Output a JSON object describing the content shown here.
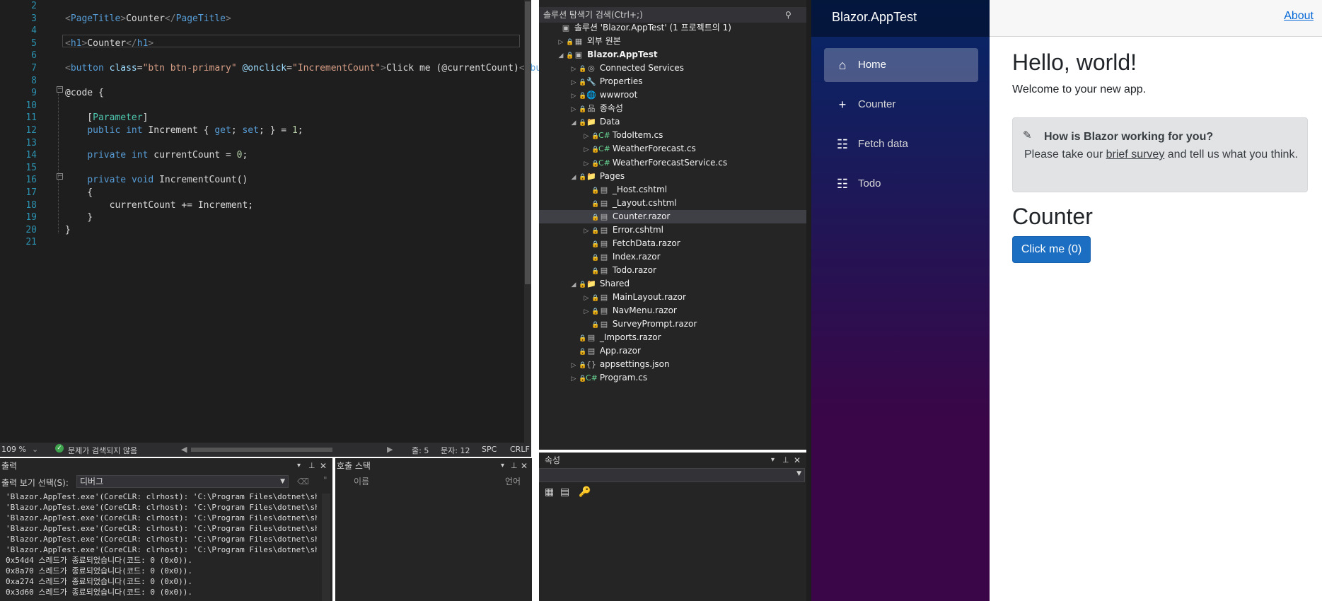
{
  "editor": {
    "lines": [
      {
        "n": "2",
        "html": ""
      },
      {
        "n": "3",
        "html": "<span class='gr'>&lt;</span><span class='tag'>PageTitle</span><span class='gr'>&gt;</span>Counter<span class='gr'>&lt;/</span><span class='tag'>PageTitle</span><span class='gr'>&gt;</span>"
      },
      {
        "n": "4",
        "html": ""
      },
      {
        "n": "5",
        "html": "<span class='gr'>&lt;</span><span class='tag'>h1</span><span class='gr'>&gt;</span>Counter<span class='gr'>&lt;/</span><span class='tag'>h1</span><span class='gr'>&gt;</span>"
      },
      {
        "n": "6",
        "html": ""
      },
      {
        "n": "7",
        "html": "<span class='gr'>&lt;</span><span class='tag'>button</span> <span class='at'>class</span>=<span class='st'>\"btn btn-primary\"</span> <span class='at'>@onclick</span>=<span class='st'>\"IncrementCount\"</span><span class='gr'>&gt;</span>Click me (@currentCount)<span class='gr'>&lt;/</span><span class='tag'>button</span><span class='gr'>&gt;</span>"
      },
      {
        "n": "8",
        "html": ""
      },
      {
        "n": "9",
        "html": "@code {"
      },
      {
        "n": "10",
        "html": ""
      },
      {
        "n": "11",
        "html": "    [<span class='cl2'>Parameter</span>]"
      },
      {
        "n": "12",
        "html": "    <span class='kw'>public</span> <span class='kw'>int</span> Increment { <span class='kw'>get</span>; <span class='kw'>set</span>; } = <span class='nm'>1</span>;"
      },
      {
        "n": "13",
        "html": ""
      },
      {
        "n": "14",
        "html": "    <span class='kw'>private</span> <span class='kw'>int</span> currentCount = <span class='nm'>0</span>;"
      },
      {
        "n": "15",
        "html": ""
      },
      {
        "n": "16",
        "html": "    <span class='kw'>private</span> <span class='kw'>void</span> IncrementCount()"
      },
      {
        "n": "17",
        "html": "    {"
      },
      {
        "n": "18",
        "html": "        currentCount += Increment;"
      },
      {
        "n": "19",
        "html": "    }"
      },
      {
        "n": "20",
        "html": "}"
      },
      {
        "n": "21",
        "html": ""
      }
    ]
  },
  "status": {
    "zoom": "109 %",
    "issues": "문제가 검색되지 않음",
    "line": "줄: 5",
    "col": "문자: 12",
    "spc": "SPC",
    "crlf": "CRLF"
  },
  "output": {
    "title": "출력",
    "show_label": "출력 보기 선택(S):",
    "show_value": "디버그",
    "lines": [
      "'Blazor.AppTest.exe'(CoreCLR: clrhost): 'C:\\Program Files\\dotnet\\shar",
      "'Blazor.AppTest.exe'(CoreCLR: clrhost): 'C:\\Program Files\\dotnet\\shar",
      "'Blazor.AppTest.exe'(CoreCLR: clrhost): 'C:\\Program Files\\dotnet\\shar",
      "'Blazor.AppTest.exe'(CoreCLR: clrhost): 'C:\\Program Files\\dotnet\\shar",
      "'Blazor.AppTest.exe'(CoreCLR: clrhost): 'C:\\Program Files\\dotnet\\shar",
      "'Blazor.AppTest.exe'(CoreCLR: clrhost): 'C:\\Program Files\\dotnet\\shar",
      "0x54d4 스레드가 종료되었습니다(코드: 0 (0x0)).",
      "0x8a70 스레드가 종료되었습니다(코드: 0 (0x0)).",
      "0xa274 스레드가 종료되었습니다(코드: 0 (0x0)).",
      "0x3d60 스레드가 종료되었습니다(코드: 0 (0x0))."
    ]
  },
  "callstack": {
    "title": "호출 스택",
    "col_name": "이름",
    "col_lang": "언어"
  },
  "solution": {
    "search": "솔루션 탐색기 검색(Ctrl+;)",
    "items": [
      {
        "label": "솔루션 'Blazor.AppTest' (1 프로젝트의 1)",
        "lvl": 0,
        "arrow": "",
        "icon": "▣",
        "bold": false
      },
      {
        "label": "외부 원본",
        "lvl": 1,
        "arrow": "▷",
        "icon": "▦",
        "bold": false
      },
      {
        "label": "Blazor.AppTest",
        "lvl": 1,
        "arrow": "◢",
        "icon": "▣",
        "bold": true
      },
      {
        "label": "Connected Services",
        "lvl": 2,
        "arrow": "▷",
        "icon": "◎",
        "bold": false
      },
      {
        "label": "Properties",
        "lvl": 2,
        "arrow": "▷",
        "icon": "🔧",
        "bold": false
      },
      {
        "label": "wwwroot",
        "lvl": 2,
        "arrow": "▷",
        "icon": "🌐",
        "bold": false
      },
      {
        "label": "종속성",
        "lvl": 2,
        "arrow": "▷",
        "icon": "品",
        "bold": false
      },
      {
        "label": "Data",
        "lvl": 2,
        "arrow": "◢",
        "icon": "📁",
        "bold": false
      },
      {
        "label": "TodoItem.cs",
        "lvl": 3,
        "arrow": "▷",
        "icon": "C#",
        "bold": false
      },
      {
        "label": "WeatherForecast.cs",
        "lvl": 3,
        "arrow": "▷",
        "icon": "C#",
        "bold": false
      },
      {
        "label": "WeatherForecastService.cs",
        "lvl": 3,
        "arrow": "▷",
        "icon": "C#",
        "bold": false
      },
      {
        "label": "Pages",
        "lvl": 2,
        "arrow": "◢",
        "icon": "📁",
        "bold": false
      },
      {
        "label": "_Host.cshtml",
        "lvl": 3,
        "arrow": "",
        "icon": "▤",
        "bold": false
      },
      {
        "label": "_Layout.cshtml",
        "lvl": 3,
        "arrow": "",
        "icon": "▤",
        "bold": false
      },
      {
        "label": "Counter.razor",
        "lvl": 3,
        "arrow": "",
        "icon": "▤",
        "bold": false,
        "selected": true
      },
      {
        "label": "Error.cshtml",
        "lvl": 3,
        "arrow": "▷",
        "icon": "▤",
        "bold": false
      },
      {
        "label": "FetchData.razor",
        "lvl": 3,
        "arrow": "",
        "icon": "▤",
        "bold": false
      },
      {
        "label": "Index.razor",
        "lvl": 3,
        "arrow": "",
        "icon": "▤",
        "bold": false
      },
      {
        "label": "Todo.razor",
        "lvl": 3,
        "arrow": "",
        "icon": "▤",
        "bold": false
      },
      {
        "label": "Shared",
        "lvl": 2,
        "arrow": "◢",
        "icon": "📁",
        "bold": false
      },
      {
        "label": "MainLayout.razor",
        "lvl": 3,
        "arrow": "▷",
        "icon": "▤",
        "bold": false
      },
      {
        "label": "NavMenu.razor",
        "lvl": 3,
        "arrow": "▷",
        "icon": "▤",
        "bold": false
      },
      {
        "label": "SurveyPrompt.razor",
        "lvl": 3,
        "arrow": "",
        "icon": "▤",
        "bold": false
      },
      {
        "label": "_Imports.razor",
        "lvl": 2,
        "arrow": "",
        "icon": "▤",
        "bold": false
      },
      {
        "label": "App.razor",
        "lvl": 2,
        "arrow": "",
        "icon": "▤",
        "bold": false
      },
      {
        "label": "appsettings.json",
        "lvl": 2,
        "arrow": "▷",
        "icon": "{}",
        "bold": false
      },
      {
        "label": "Program.cs",
        "lvl": 2,
        "arrow": "▷",
        "icon": "C#",
        "bold": false
      }
    ]
  },
  "properties": {
    "title": "속성"
  },
  "browser": {
    "brand": "Blazor.AppTest",
    "about": "About",
    "nav": [
      {
        "label": "Home",
        "icon": "home-icon",
        "glyph": "⌂",
        "active": true
      },
      {
        "label": "Counter",
        "icon": "plus-icon",
        "glyph": "+",
        "active": false
      },
      {
        "label": "Fetch data",
        "icon": "list-icon",
        "glyph": "☷",
        "active": false
      },
      {
        "label": "Todo",
        "icon": "list-icon",
        "glyph": "☷",
        "active": false
      }
    ],
    "hello": "Hello, world!",
    "welcome": "Welcome to your new app.",
    "survey_title": "How is Blazor working for you?",
    "survey_pre": "Please take our ",
    "survey_link": "brief survey",
    "survey_post": " and tell us what you think.",
    "counter_title": "Counter",
    "counter_button": "Click me (0)"
  }
}
